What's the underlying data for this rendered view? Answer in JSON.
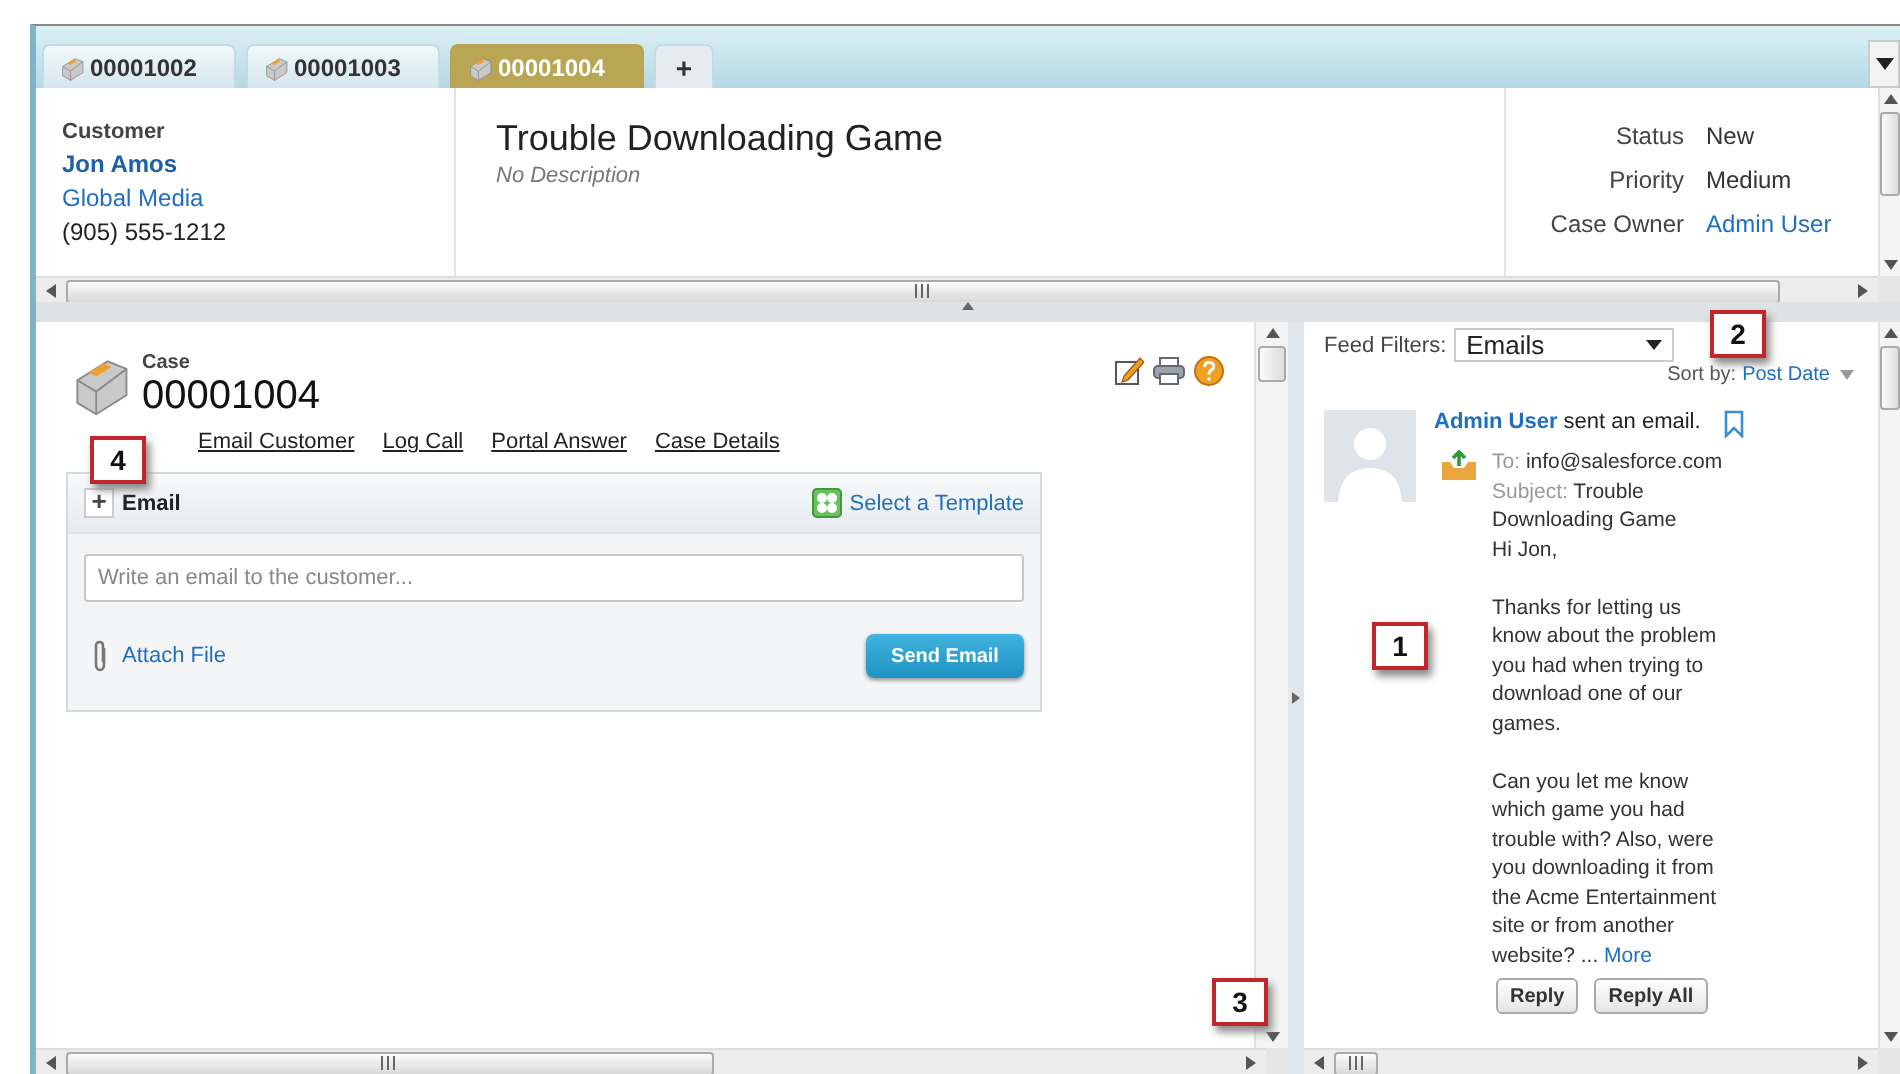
{
  "tabs": [
    {
      "label": "00001002",
      "selected": false
    },
    {
      "label": "00001003",
      "selected": false
    },
    {
      "label": "00001004",
      "selected": true
    }
  ],
  "add_tab": "+",
  "header": {
    "customer": {
      "label": "Customer",
      "name": "Jon Amos",
      "account": "Global Media",
      "phone": "(905) 555-1212"
    },
    "case": {
      "subject": "Trouble Downloading Game",
      "description": "No Description"
    },
    "fields": [
      {
        "label": "Status",
        "value": "New",
        "kind": "text"
      },
      {
        "label": "Priority",
        "value": "Medium",
        "kind": "text"
      },
      {
        "label": "Case Owner",
        "value": "Admin User",
        "kind": "link"
      }
    ]
  },
  "case": {
    "type_label": "Case",
    "number": "00001004",
    "actions": [
      "Email Customer",
      "Log Call",
      "Portal Answer",
      "Case Details"
    ],
    "actions_callout": "4",
    "publisher": {
      "expand": "+",
      "title": "Email",
      "template": "Select a Template",
      "placeholder": "Write an email to the customer...",
      "attach": "Attach File",
      "send": "Send Email"
    },
    "panel_callout": "3"
  },
  "feed": {
    "filter_label": "Feed Filters:",
    "filter_value": "Emails",
    "filter_callout": "2",
    "sort_label": "Sort by:",
    "sort_value": "Post Date",
    "item": {
      "author": "Admin User",
      "action": "sent an email.",
      "to_label": "To:",
      "to": "info@salesforce.com",
      "subject_label": "Subject:",
      "subject": "Trouble Downloading Game",
      "paragraphs": [
        "Hi Jon,",
        "Thanks for letting us know about the problem you had when trying to download one of our games.",
        "Can you let me know which game you had trouble with? Also, were you downloading it from the Acme Entertainment site or from another website? ..."
      ],
      "more": "More",
      "buttons": [
        "Reply",
        "Reply All"
      ]
    },
    "callout": "1"
  }
}
